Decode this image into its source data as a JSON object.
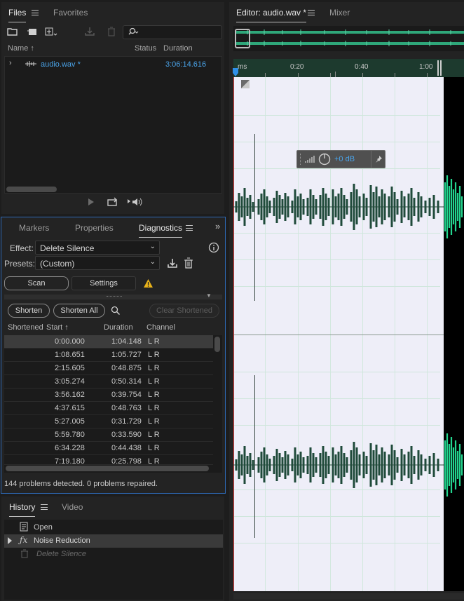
{
  "files_panel": {
    "tabs": [
      "Files",
      "Favorites"
    ],
    "columns": {
      "name": "Name",
      "status": "Status",
      "duration": "Duration"
    },
    "file": {
      "name": "audio.wav *",
      "duration": "3:06:14.616"
    }
  },
  "diagnostics_panel": {
    "tabs": [
      "Markers",
      "Properties",
      "Diagnostics"
    ],
    "effect_label": "Effect:",
    "effect_value": "Delete Silence",
    "presets_label": "Presets:",
    "presets_value": "(Custom)",
    "scan_label": "Scan",
    "settings_label": "Settings",
    "shorten_label": "Shorten",
    "shorten_all_label": "Shorten All",
    "clear_shortened_label": "Clear Shortened",
    "columns": {
      "shortened": "Shortened",
      "start": "Start",
      "duration": "Duration",
      "channel": "Channel"
    },
    "rows": [
      {
        "start": "0:00.000",
        "duration": "1:04.148",
        "channel": "L R"
      },
      {
        "start": "1:08.651",
        "duration": "1:05.727",
        "channel": "L R"
      },
      {
        "start": "2:15.605",
        "duration": "0:48.875",
        "channel": "L R"
      },
      {
        "start": "3:05.274",
        "duration": "0:50.314",
        "channel": "L R"
      },
      {
        "start": "3:56.162",
        "duration": "0:39.754",
        "channel": "L R"
      },
      {
        "start": "4:37.615",
        "duration": "0:48.763",
        "channel": "L R"
      },
      {
        "start": "5:27.005",
        "duration": "0:31.729",
        "channel": "L R"
      },
      {
        "start": "5:59.780",
        "duration": "0:33.590",
        "channel": "L R"
      },
      {
        "start": "6:34.228",
        "duration": "0:44.438",
        "channel": "L R"
      },
      {
        "start": "7:19.180",
        "duration": "0:25.798",
        "channel": "L R"
      }
    ],
    "status": "144 problems detected. 0 problems repaired."
  },
  "history_panel": {
    "tabs": [
      "History",
      "Video"
    ],
    "items": [
      "Open",
      "Noise Reduction",
      "Delete Silence"
    ]
  },
  "editor_panel": {
    "tabs": [
      "Editor: audio.wav *",
      "Mixer"
    ],
    "ruler_labels": [
      "ms",
      "0:20",
      "0:40",
      "1:00"
    ],
    "hud_value": "+0 dB"
  },
  "colors": {
    "accent_blue": "#2e6ab8",
    "file_blue": "#4aa3e8",
    "wave_green": "#1f4a3a",
    "wave_highlight": "#23d58f",
    "warning": "#e8b21a"
  }
}
